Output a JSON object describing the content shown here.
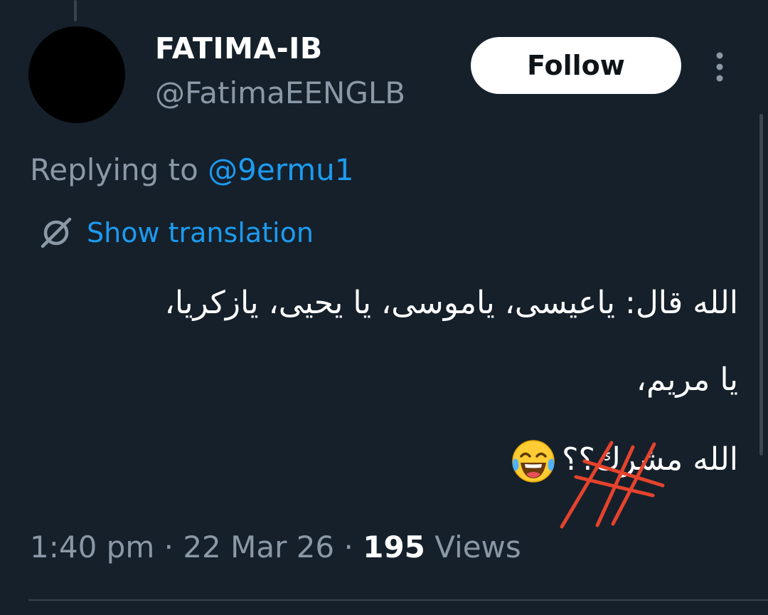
{
  "author": {
    "display_name": "FATIMA-IB",
    "handle": "@FatimaEENGLB"
  },
  "actions": {
    "follow_label": "Follow",
    "more_icon": "more-vertical-icon"
  },
  "reply": {
    "prefix": "Replying to ",
    "mention": "@9ermu1"
  },
  "translation": {
    "icon": "globe-slash-icon",
    "label": "Show translation"
  },
  "tweet": {
    "lines": [
      "الله قال: ياعيسى، ياموسى، يا يحيى، يازكريا،",
      "يا مريم،",
      "الله مشرك؟؟"
    ],
    "emoji": "face-with-tears-of-joy-icon",
    "annotation": "red-scribble-strikethrough"
  },
  "meta": {
    "time": "1:40 pm",
    "separator": " · ",
    "date": "22 Mar 26",
    "views_count": "195",
    "views_label": " Views"
  },
  "colors": {
    "background": "#15202b",
    "link": "#1d9bf0",
    "muted": "#8b98a5",
    "scribble": "#e5432d"
  }
}
